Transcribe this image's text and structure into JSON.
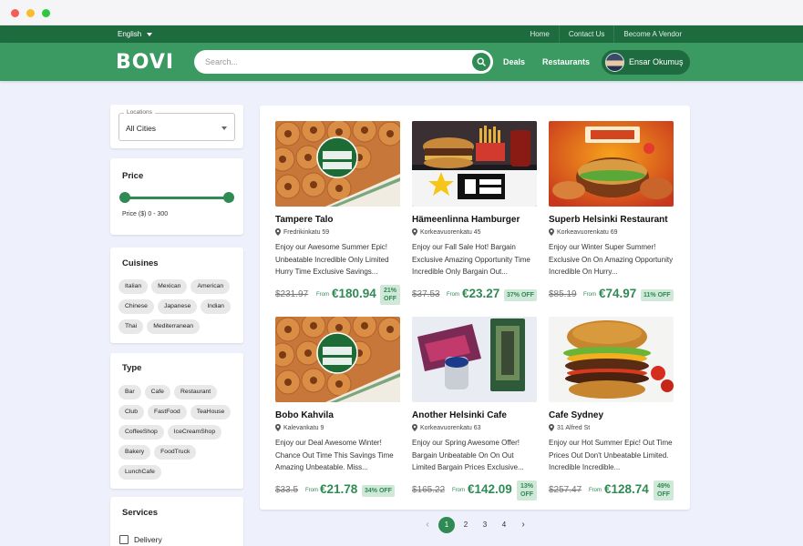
{
  "topbar": {
    "language": "English",
    "links": [
      "Home",
      "Contact Us",
      "Become A Vendor"
    ]
  },
  "header": {
    "logo": "BOVI",
    "search_placeholder": "Search...",
    "nav": [
      "Deals",
      "Restaurants"
    ],
    "user_name": "Ensar Okumuş"
  },
  "filters": {
    "locations_legend": "Locations",
    "locations_value": "All Cities",
    "price_title": "Price",
    "price_range": "Price ($) 0 - 300",
    "price_min_fraction": 0.0,
    "price_max_fraction": 1.0,
    "cuisines_title": "Cuisines",
    "cuisines": [
      "Italian",
      "Mexican",
      "American",
      "Chinese",
      "Japanese",
      "Indian",
      "Thai",
      "Mediterranean"
    ],
    "type_title": "Type",
    "types": [
      "Bar",
      "Cafe",
      "Restaurant",
      "Club",
      "FastFood",
      "TeaHouse",
      "CoffeeShop",
      "IceCreamShop",
      "Bakery",
      "FoodTruck",
      "LunchCafe"
    ],
    "services_title": "Services",
    "services": [
      "Delivery"
    ]
  },
  "cards": [
    {
      "title": "Tampere Talo",
      "address": "Fredrikinkatu 59",
      "description": "Enjoy our Awesome Summer Epic! Unbeatable Incredible Only Limited Hurry Time Exclusive Savings...",
      "old_price": "$231.97",
      "from": "From",
      "price": "€180.94",
      "off_line1": "21%",
      "off_line2": "OFF",
      "image": "donuts"
    },
    {
      "title": "Hämeenlinna Hamburger",
      "address": "Korkeavuorenkatu 45",
      "description": "Enjoy our Fall Sale Hot! Bargain Exclusive Amazing Opportunity Time Incredible Only Bargain Out...",
      "old_price": "$37.53",
      "from": "From",
      "price": "€23.27",
      "off_line1": "37% OFF",
      "off_line2": "",
      "image": "meal"
    },
    {
      "title": "Superb Helsinki Restaurant",
      "address": "Korkeavuorenkatu 69",
      "description": "Enjoy our Winter Super Summer! Exclusive On On Amazing Opportunity Incredible On Hurry...",
      "old_price": "$85.19",
      "from": "From",
      "price": "€74.97",
      "off_line1": "11% OFF",
      "off_line2": "",
      "image": "menu"
    },
    {
      "title": "Bobo Kahvila",
      "address": "Kalevankatu 9",
      "description": "Enjoy our Deal Awesome Winter! Chance Out Time This Savings Time Amazing Unbeatable. Miss...",
      "old_price": "$33.5",
      "from": "From",
      "price": "€21.78",
      "off_line1": "34% OFF",
      "off_line2": "",
      "image": "donuts"
    },
    {
      "title": "Another Helsinki Cafe",
      "address": "Korkeavuorenkatu 63",
      "description": "Enjoy our Spring Awesome Offer! Bargain Unbeatable On On Out Limited Bargain Prices Exclusive...",
      "old_price": "$165.22",
      "from": "From",
      "price": "€142.09",
      "off_line1": "13%",
      "off_line2": "OFF",
      "image": "snacks"
    },
    {
      "title": "Cafe Sydney",
      "address": "31 Alfred St",
      "description": "Enjoy our Hot Summer Epic! Out Time Prices Out Don't Unbeatable Limited. Incredible Incredible...",
      "old_price": "$257.47",
      "from": "From",
      "price": "€128.74",
      "off_line1": "49%",
      "off_line2": "OFF",
      "image": "burger"
    }
  ],
  "pagination": {
    "prev": "‹",
    "pages": [
      "1",
      "2",
      "3",
      "4"
    ],
    "next": "›",
    "active": "1"
  },
  "colors": {
    "primary": "#3a9a61",
    "dark": "#1f6b40",
    "accent": "#2f8a54"
  }
}
